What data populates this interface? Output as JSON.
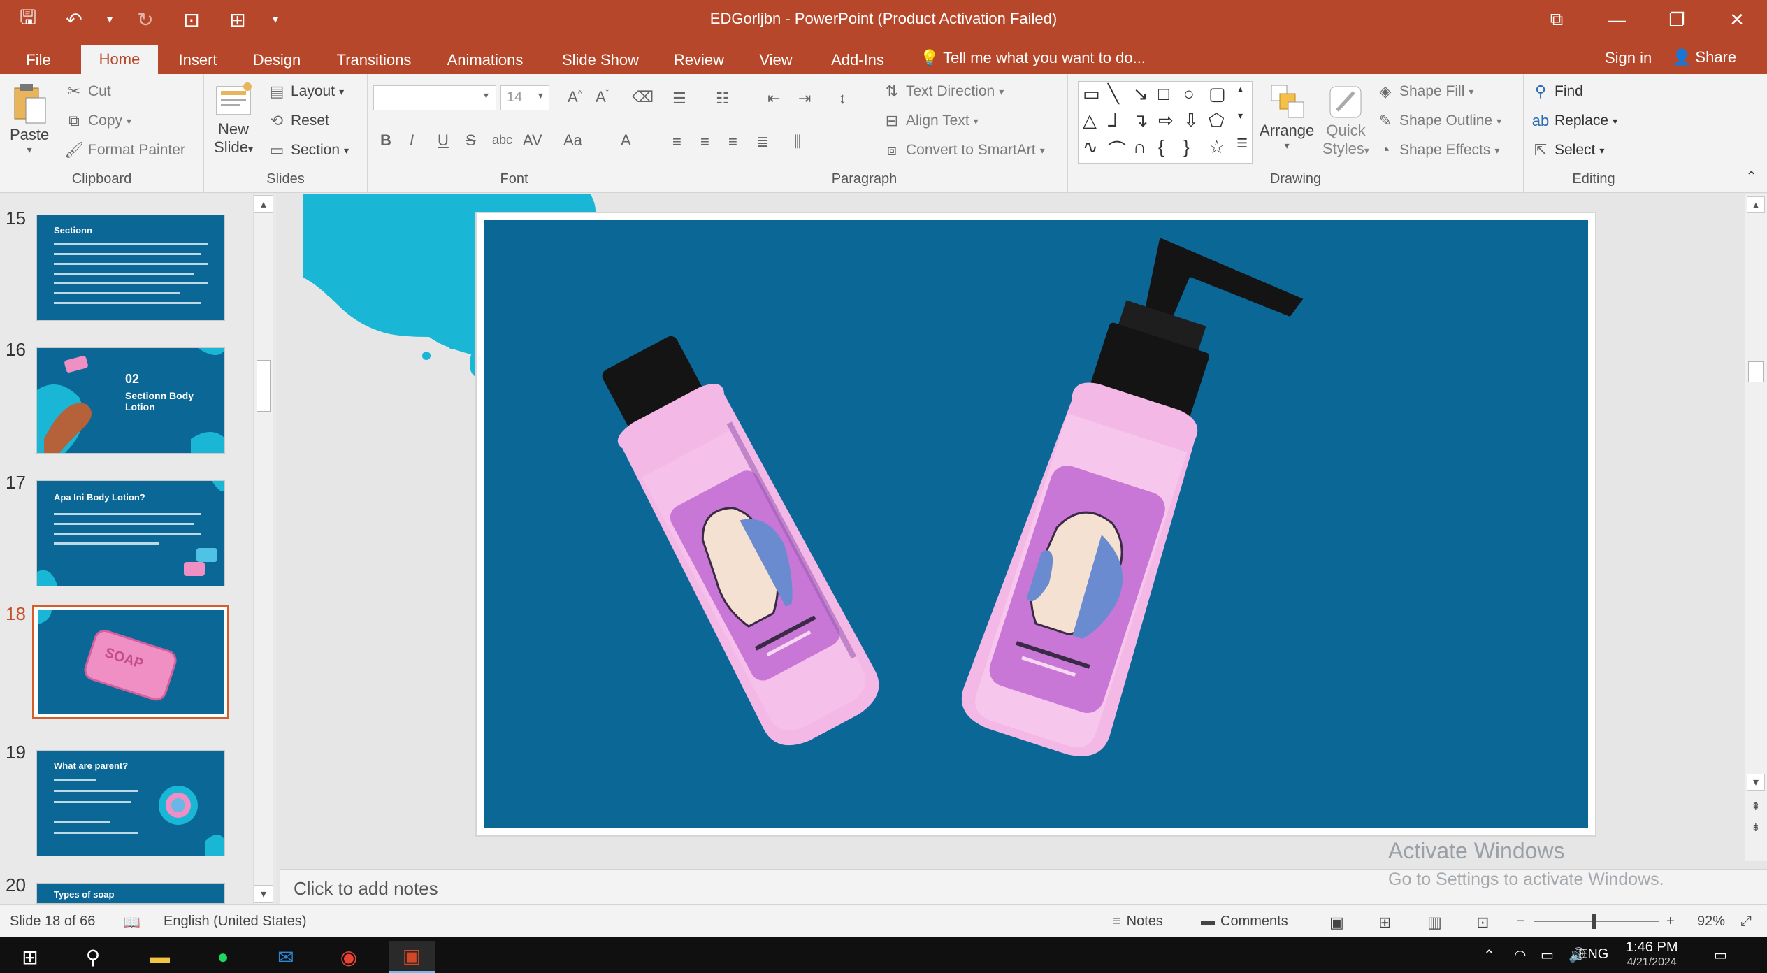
{
  "window": {
    "title": "EDGorljbn - PowerPoint (Product Activation Failed)",
    "controls": [
      "⧉",
      "—",
      "❐",
      "✕"
    ]
  },
  "qat": {
    "save": "🖫",
    "undo": "↶",
    "undo_arrow": "▾",
    "redo": "↻",
    "present": "⊡",
    "customize": "⊞",
    "more": "▾"
  },
  "tabs": [
    "File",
    "Home",
    "Insert",
    "Design",
    "Transitions",
    "Animations",
    "Slide Show",
    "Review",
    "View",
    "Add-Ins"
  ],
  "tell_me": "Tell me what you want to do...",
  "sign_in": "Sign in",
  "share": "Share",
  "ribbon": {
    "clipboard": {
      "label": "Clipboard",
      "paste": "Paste",
      "cut": "Cut",
      "copy": "Copy",
      "format_painter": "Format Painter"
    },
    "slides": {
      "label": "Slides",
      "new_slide": "New",
      "new_slide_2": "Slide",
      "layout": "Layout",
      "reset": "Reset",
      "section": "Section"
    },
    "font": {
      "label": "Font",
      "size": "14",
      "bold": "B",
      "italic": "I",
      "underline": "U",
      "strike": "S",
      "clear": "A"
    },
    "paragraph": {
      "label": "Paragraph",
      "text_direction": "Text Direction",
      "align_text": "Align Text",
      "smartart": "Convert to SmartArt"
    },
    "drawing": {
      "label": "Drawing",
      "arrange": "Arrange",
      "quick_styles": "Quick",
      "quick_styles_2": "Styles",
      "shape_fill": "Shape Fill",
      "shape_outline": "Shape Outline",
      "shape_effects": "Shape Effects"
    },
    "editing": {
      "label": "Editing",
      "find": "Find",
      "replace": "Replace",
      "select": "Select"
    }
  },
  "slides": [
    {
      "num": "15",
      "title": "Sectionn"
    },
    {
      "num": "16",
      "title": "02",
      "subtitle": "Sectionn Body Lotion"
    },
    {
      "num": "17",
      "title": "Apa Ini Body Lotion?"
    },
    {
      "num": "18",
      "title": "SOAP"
    },
    {
      "num": "19",
      "title": "What are parent?"
    },
    {
      "num": "20",
      "title": "Types of soap"
    }
  ],
  "notes_placeholder": "Click to add notes",
  "watermark": {
    "line1": "Activate Windows",
    "line2": "Go to Settings to activate Windows."
  },
  "status": {
    "slide": "Slide 18 of 66",
    "language": "English (United States)",
    "notes": "Notes",
    "comments": "Comments",
    "zoom": "92%"
  },
  "taskbar": {
    "time": "1:46 PM",
    "date": "4/21/2024",
    "lang": "ENG"
  },
  "colors": {
    "accent": "#b7472a",
    "slide_bg": "#0b6795",
    "splash": "#1ab6d6",
    "bottle_pink": "#f3b8e6",
    "label_purple": "#c977d6"
  }
}
